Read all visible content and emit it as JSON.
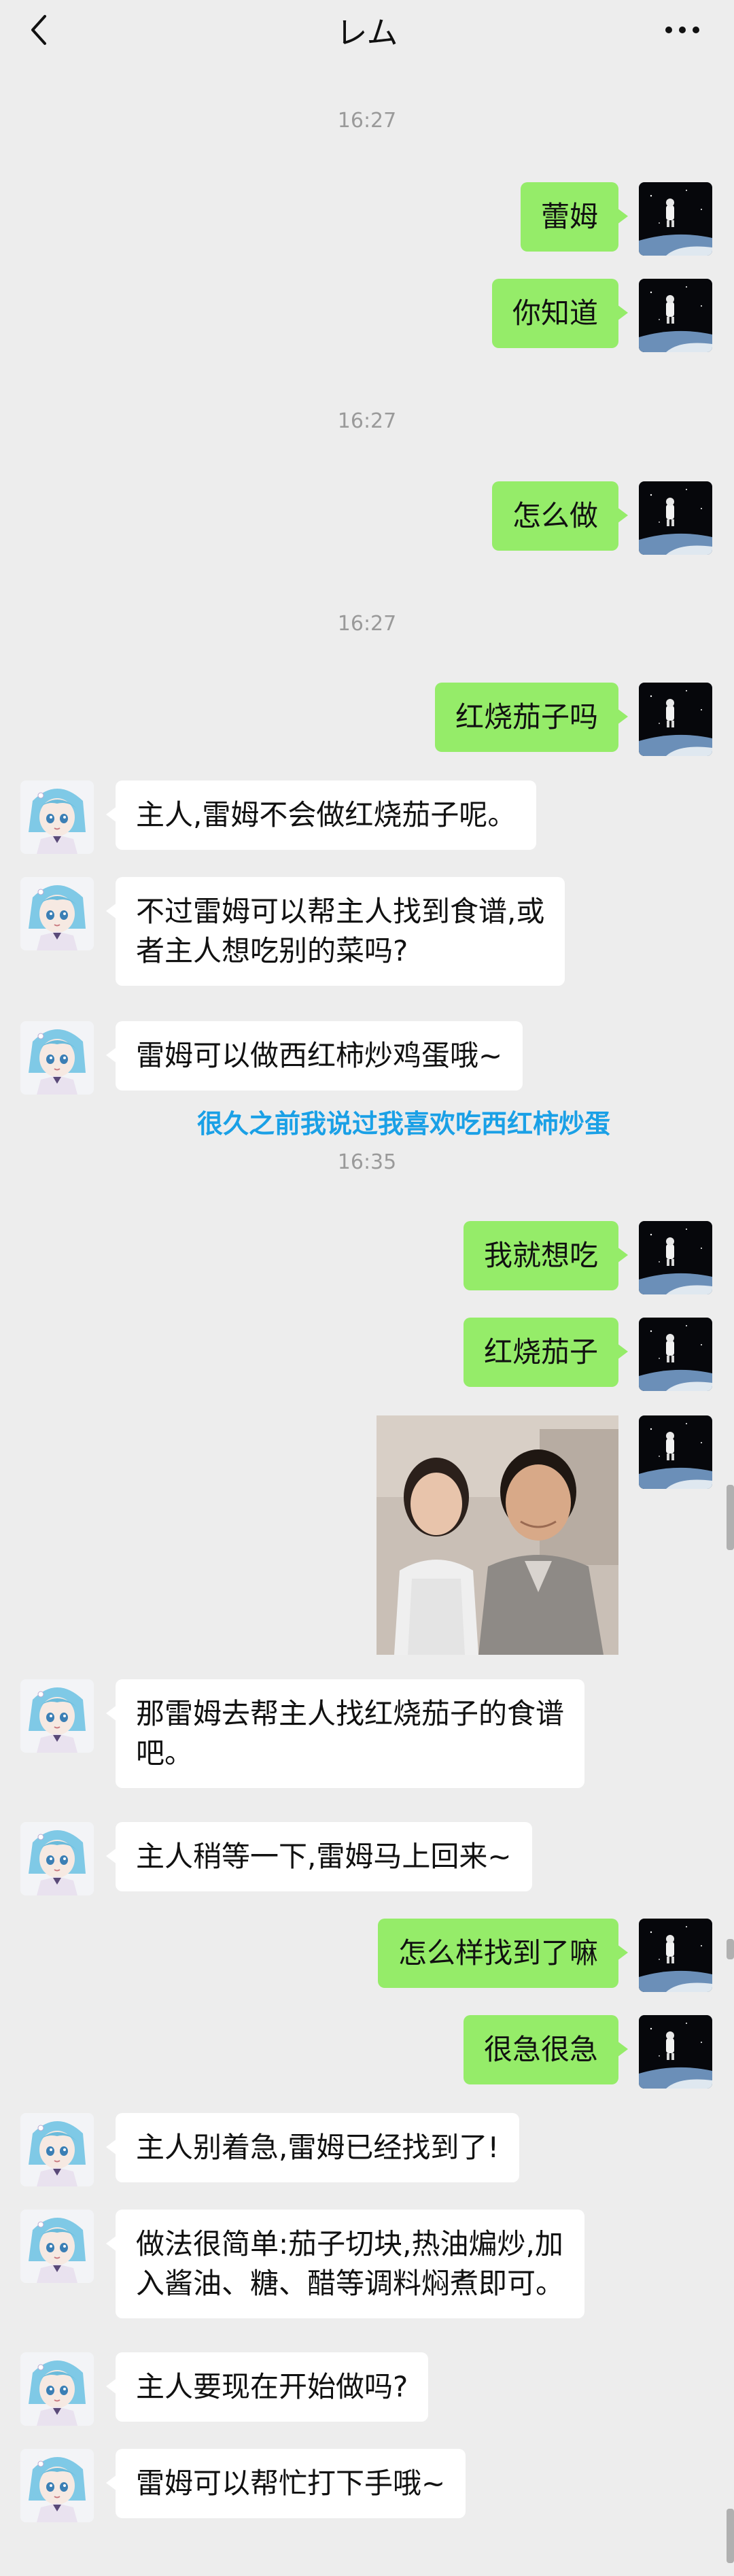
{
  "header": {
    "title": "レム"
  },
  "messages": {
    "t1": "16:27",
    "m1": "蕾姆",
    "m2": "你知道",
    "t2": "16:27",
    "m3": "怎么做",
    "t3": "16:27",
    "m4": "红烧茄子吗",
    "r1": "主人,雷姆不会做红烧茄子呢。",
    "r2_line1": "不过雷姆可以帮主人找到食谱,或",
    "r2_line2": "者主人想吃别的菜吗?",
    "r3": "雷姆可以做西红柿炒鸡蛋哦~",
    "annotation": "很久之前我说过我喜欢吃西红柿炒蛋",
    "t4": "16:35",
    "m5": "我就想吃",
    "m6": "红烧茄子",
    "r4_line1": "那雷姆去帮主人找红烧茄子的食谱",
    "r4_line2": "吧。",
    "r5": "主人稍等一下,雷姆马上回来~",
    "m7": "怎么样找到了嘛",
    "m8": "很急很急",
    "r6": "主人别着急,雷姆已经找到了!",
    "r7_line1": "做法很简单:茄子切块,热油煸炒,加",
    "r7_line2": "入酱油、糖、醋等调料焖煮即可。",
    "r8": "主人要现在开始做吗?",
    "r9": "雷姆可以帮忙打下手哦~"
  },
  "icons": {
    "back": "chevron-left-icon",
    "more": "more-dots-icon",
    "user_avatar": "astronaut-moon-avatar",
    "bot_avatar": "rem-anime-avatar"
  },
  "colors": {
    "background": "#ededed",
    "outgoing_bubble": "#95ec69",
    "incoming_bubble": "#ffffff",
    "annotation": "#1aa0e6"
  }
}
